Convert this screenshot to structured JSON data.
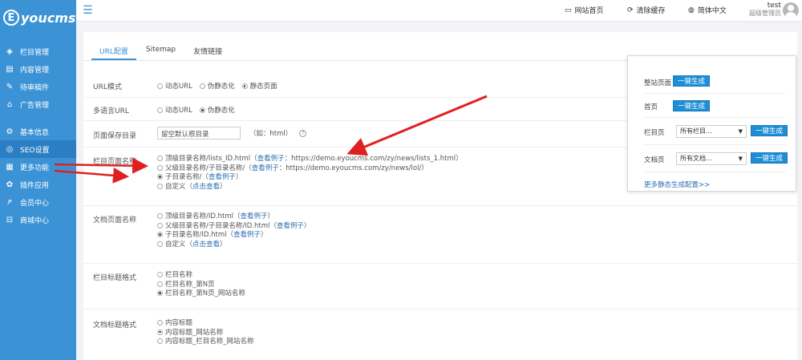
{
  "brand": {
    "logo_letter": "E",
    "logo_text": "youcms"
  },
  "sidebar": {
    "items": [
      {
        "label": "栏目管理",
        "icon": "layers-icon"
      },
      {
        "label": "内容管理",
        "icon": "doc-icon"
      },
      {
        "label": "待审稿件",
        "icon": "edit-icon"
      },
      {
        "label": "广告管理",
        "icon": "ad-icon"
      },
      {
        "label": "基本信息",
        "icon": "gear-icon"
      },
      {
        "label": "SEO设置",
        "icon": "seo-icon"
      },
      {
        "label": "更多功能",
        "icon": "grid-icon"
      },
      {
        "label": "插件应用",
        "icon": "plugin-icon"
      },
      {
        "label": "会员中心",
        "icon": "user-icon"
      },
      {
        "label": "商城中心",
        "icon": "cart-icon"
      }
    ],
    "active": "SEO设置"
  },
  "topbar": {
    "home_label": "网站首页",
    "clear_cache_label": "清除缓存",
    "language_label": "简体中文",
    "user_name": "test",
    "user_role": "超级管理员"
  },
  "tabs": [
    {
      "label": "URL配置",
      "active": true
    },
    {
      "label": "Sitemap",
      "active": false
    },
    {
      "label": "友情链接",
      "active": false
    }
  ],
  "form": {
    "url_mode": {
      "label": "URL模式",
      "options": [
        "动态URL",
        "伪静态化",
        "静态页面"
      ],
      "selected": 2
    },
    "multi_lang_url": {
      "label": "多语言URL",
      "options": [
        "动态URL",
        "伪静态化"
      ],
      "selected": 1
    },
    "save_dir": {
      "label": "页面保存目录",
      "placeholder": "留空默认根目录",
      "hint": "（如：html）",
      "help_icon": "?"
    },
    "column_page_name": {
      "label": "栏目页面名称",
      "opt1_pre": "顶级目录名称/lists_ID.html（",
      "opt1_link": "查看例子",
      "opt1_post": "：https://demo.eyoucms.com/zy/news/lists_1.html）",
      "opt2_pre": "父级目录名称/子目录名称/（",
      "opt2_link": "查看例子",
      "opt2_post": "：https://demo.eyoucms.com/zy/news/lol/）",
      "opt3_pre": "子目录名称/（",
      "opt3_link": "查看例子",
      "opt3_post": "）",
      "opt4_pre": "自定义（",
      "opt4_link": "点击查看",
      "opt4_post": "）",
      "selected": 2
    },
    "doc_page_name": {
      "label": "文档页面名称",
      "opt1_pre": "顶级目录名称/ID.html（",
      "opt1_link": "查看例子",
      "opt1_post": "）",
      "opt2_pre": "父级目录名称/子目录名称/ID.html（",
      "opt2_link": "查看例子",
      "opt2_post": "）",
      "opt3_pre": "子目录名称/ID.html（",
      "opt3_link": "查看例子",
      "opt3_post": "）",
      "opt4_pre": "自定义（",
      "opt4_link": "点击查看",
      "opt4_post": "）",
      "selected": 2
    },
    "column_title_format": {
      "label": "栏目标题格式",
      "options": [
        "栏目名称",
        "栏目名称_第N页",
        "栏目名称_第N页_网站名称"
      ],
      "selected": 2
    },
    "doc_title_format": {
      "label": "文档标题格式",
      "options": [
        "内容标题",
        "内容标题_网站名称",
        "内容标题_栏目名称_网站名称"
      ],
      "selected": 1
    }
  },
  "popup": {
    "whole_site_label": "整站页面",
    "home_label": "首页",
    "column_label": "栏目页",
    "doc_label": "文档页",
    "generate_label": "一键生成",
    "column_select": "所有栏目...",
    "doc_select": "所有文档...",
    "more_link": "更多静态生成配置>>"
  },
  "colors": {
    "sidebar": "#3b93d6",
    "sidebar_active": "#2b7ec3",
    "button": "#1e8fd6",
    "link": "#2a6fb0",
    "arrow": "#e02020"
  }
}
